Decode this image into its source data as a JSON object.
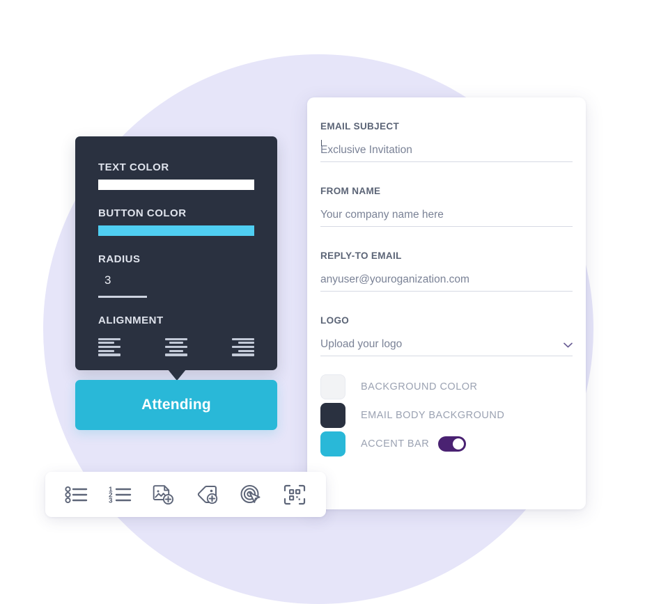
{
  "theme": {
    "accent_cyan": "#29b8d8",
    "dark_panel": "#2a3140",
    "lavender_blob": "#e6e5f9",
    "toggle_purple": "#4a2272",
    "white": "#ffffff",
    "body_dark": "#2a3140",
    "light_grey": "#eef0f2"
  },
  "style_panel": {
    "text_color": {
      "label": "TEXT COLOR",
      "value": "#ffffff"
    },
    "button_color": {
      "label": "BUTTON COLOR",
      "value": "#4fcef2"
    },
    "radius": {
      "label": "RADIUS",
      "value": "3"
    },
    "alignment": {
      "label": "ALIGNMENT",
      "options": [
        {
          "name": "align-left",
          "icon": "align-left-icon"
        },
        {
          "name": "align-center",
          "icon": "align-center-icon"
        },
        {
          "name": "align-right",
          "icon": "align-right-icon"
        }
      ]
    }
  },
  "preview": {
    "button_label": "Attending"
  },
  "email_form": {
    "fields": [
      {
        "label": "EMAIL SUBJECT",
        "value": "Exclusive Invitation",
        "placeholder": "Exclusive Invitation",
        "has_caret": true,
        "type": "text"
      },
      {
        "label": "FROM NAME",
        "value": "Your company name here",
        "placeholder": "Your company name here",
        "has_caret": false,
        "type": "text"
      },
      {
        "label": "REPLY-TO EMAIL",
        "value": "anyuser@youroganization.com",
        "placeholder": "anyuser@youroganization.com",
        "has_caret": false,
        "type": "email"
      },
      {
        "label": "LOGO",
        "value": "Upload your logo",
        "placeholder": "Upload your logo",
        "has_caret": false,
        "type": "select",
        "icon": "chevron-down-icon"
      }
    ],
    "swatches": [
      {
        "label": "BACKGROUND COLOR",
        "color": "#f2f3f5",
        "name": "background-color",
        "has_toggle": false
      },
      {
        "label": "EMAIL BODY BACKGROUND",
        "color": "#2a3140",
        "name": "email-body-background",
        "has_toggle": false
      },
      {
        "label": "ACCENT BAR",
        "color": "#29b8d8",
        "name": "accent-bar",
        "has_toggle": true,
        "toggle_on": true
      }
    ]
  },
  "toolbar": {
    "items": [
      {
        "name": "bulleted-list-icon",
        "label": "Bulleted list"
      },
      {
        "name": "numbered-list-icon",
        "label": "Numbered list"
      },
      {
        "name": "add-image-icon",
        "label": "Add image"
      },
      {
        "name": "add-tag-icon",
        "label": "Add tag"
      },
      {
        "name": "click-target-icon",
        "label": "Click target"
      },
      {
        "name": "qr-code-icon",
        "label": "QR code"
      }
    ]
  }
}
